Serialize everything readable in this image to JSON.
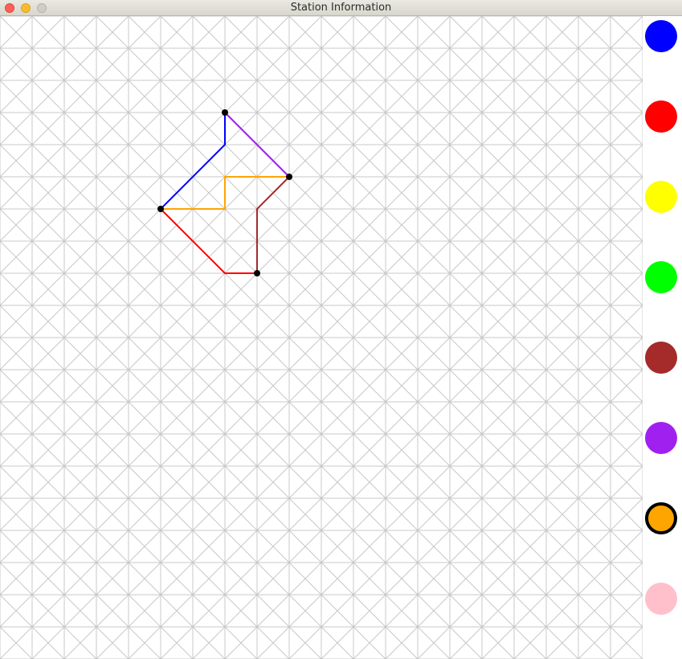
{
  "window": {
    "title": "Station Information"
  },
  "grid": {
    "line_color": "#c8c8c8"
  },
  "stations": [
    {
      "id": "s1",
      "col": 7,
      "row": 3
    },
    {
      "id": "s2",
      "col": 9,
      "row": 5
    },
    {
      "id": "s3",
      "col": 5,
      "row": 6
    },
    {
      "id": "s4",
      "col": 8,
      "row": 8
    }
  ],
  "lines": [
    {
      "name": "blue",
      "color": "#0000ff",
      "path": [
        [
          5,
          6
        ],
        [
          7,
          4
        ],
        [
          7,
          3
        ]
      ]
    },
    {
      "name": "purple",
      "color": "#a020f0",
      "path": [
        [
          7,
          3
        ],
        [
          9,
          5
        ]
      ]
    },
    {
      "name": "orange",
      "color": "#ffa500",
      "path": [
        [
          5,
          6
        ],
        [
          7,
          6
        ],
        [
          7,
          5
        ],
        [
          9,
          5
        ]
      ]
    },
    {
      "name": "brown",
      "color": "#a52a2a",
      "path": [
        [
          9,
          5
        ],
        [
          8,
          6
        ],
        [
          8,
          8
        ]
      ]
    },
    {
      "name": "red",
      "color": "#ff0000",
      "path": [
        [
          5,
          6
        ],
        [
          7,
          8
        ],
        [
          8,
          8
        ]
      ]
    }
  ],
  "palette": {
    "selected": "orange",
    "colors": [
      {
        "name": "blue",
        "hex": "#0000ff"
      },
      {
        "name": "red",
        "hex": "#ff0000"
      },
      {
        "name": "yellow",
        "hex": "#ffff00"
      },
      {
        "name": "green",
        "hex": "#00ff00"
      },
      {
        "name": "brown",
        "hex": "#a52a2a"
      },
      {
        "name": "purple",
        "hex": "#a020f0"
      },
      {
        "name": "orange",
        "hex": "#ffa500"
      },
      {
        "name": "pink",
        "hex": "#ffc0cb"
      }
    ]
  }
}
